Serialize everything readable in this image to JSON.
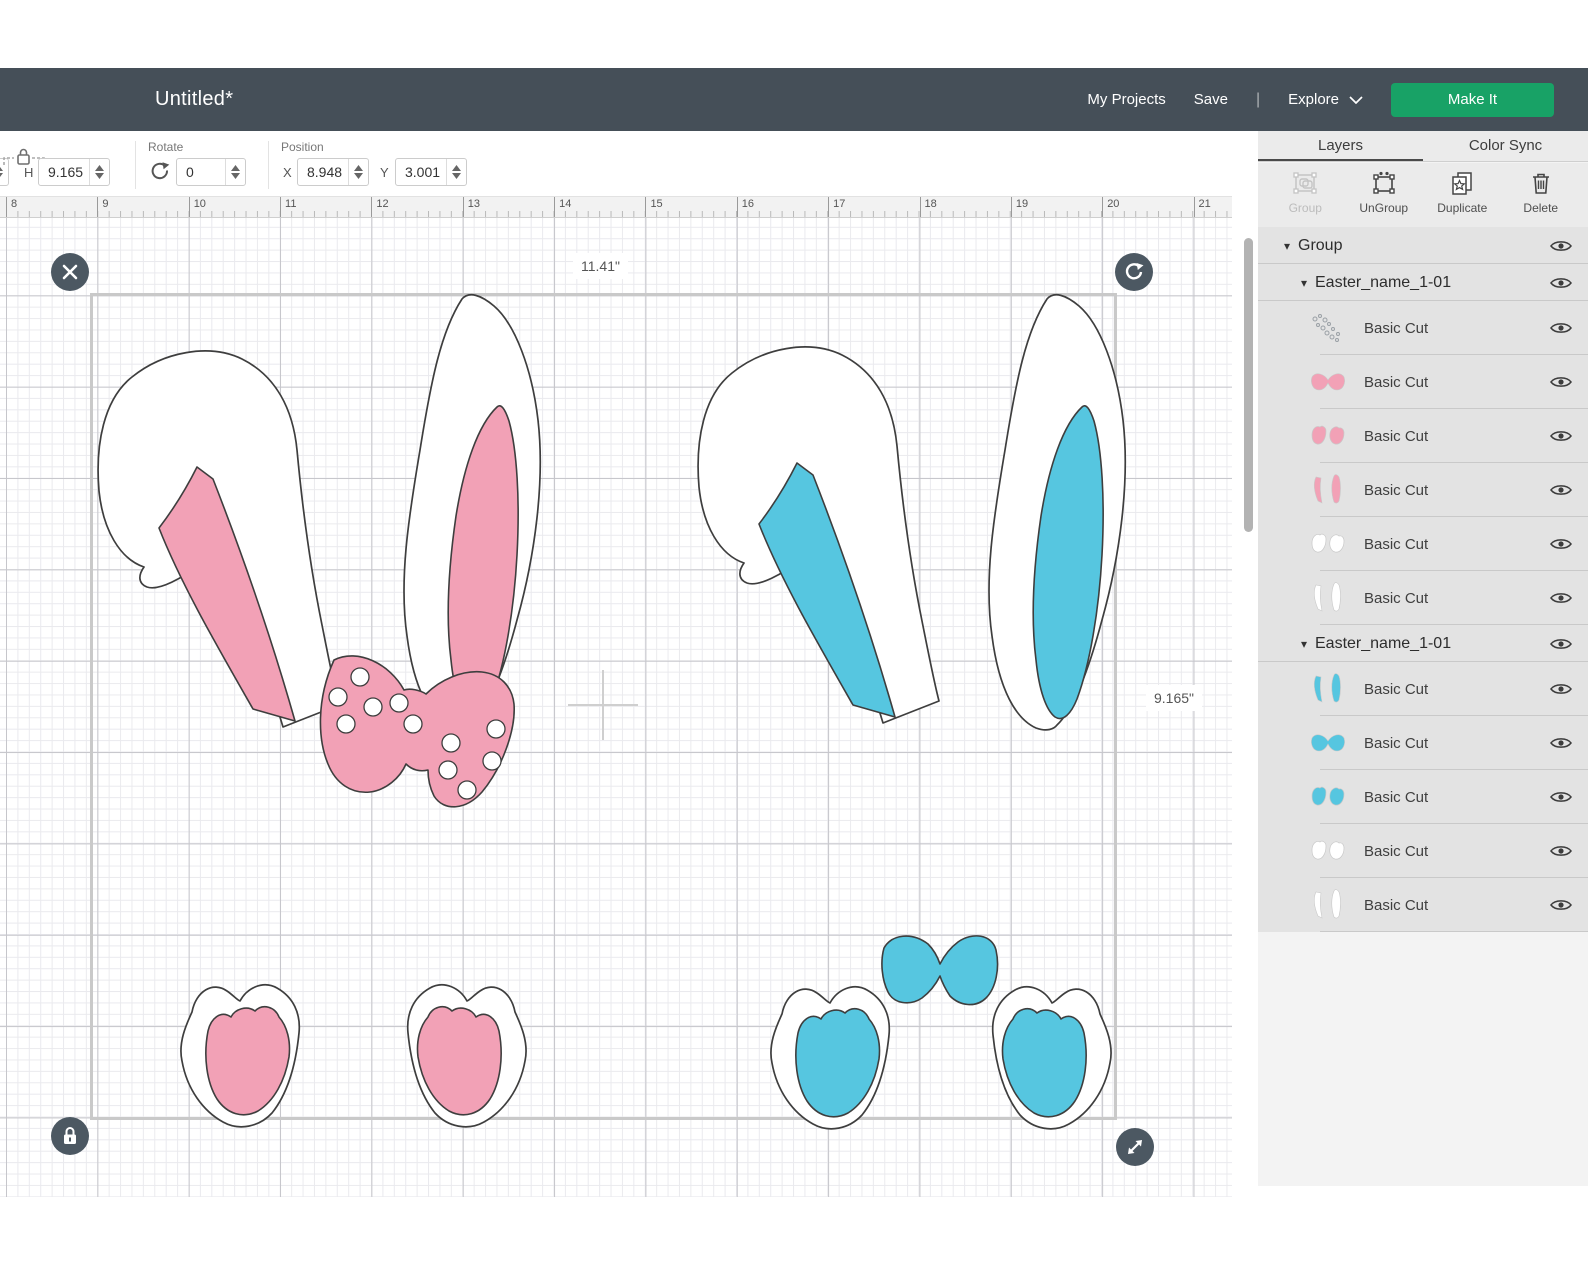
{
  "colors": {
    "header_bar": "#454F58",
    "make_it": "#18A266",
    "pink": "#F2A1B6",
    "blue": "#56C6E0",
    "outline": "#3E3E3E"
  },
  "header": {
    "title": "Untitled*",
    "my_projects": "My Projects",
    "save": "Save",
    "divider": "|",
    "explore": "Explore",
    "make_it": "Make It"
  },
  "toolbar": {
    "h_label": "H",
    "h_value": "9.165",
    "rotate_label": "Rotate",
    "rotate_value": "0",
    "position_label": "Position",
    "x_label": "X",
    "x_value": "8.948",
    "y_label": "Y",
    "y_value": "3.001"
  },
  "ruler": {
    "numbers": [
      "8",
      "9",
      "10",
      "11",
      "12",
      "13",
      "14",
      "15",
      "16",
      "17",
      "18",
      "19",
      "20",
      "21"
    ]
  },
  "canvas": {
    "selection_width_label": "11.41\"",
    "selection_height_label": "9.165\""
  },
  "panel": {
    "tabs": [
      {
        "label": "Layers",
        "active": true
      },
      {
        "label": "Color Sync",
        "active": false
      }
    ],
    "actions": [
      {
        "label": "Group",
        "disabled": true
      },
      {
        "label": "UnGroup",
        "disabled": false
      },
      {
        "label": "Duplicate",
        "disabled": false
      },
      {
        "label": "Delete",
        "disabled": false
      }
    ],
    "layers": [
      {
        "kind": "group",
        "label": "Group",
        "indent": 0
      },
      {
        "kind": "group",
        "label": "Easter_name_1-01",
        "indent": 1
      },
      {
        "kind": "item",
        "label": "Basic Cut",
        "thumb": "dots"
      },
      {
        "kind": "item",
        "label": "Basic Cut",
        "thumb": "bow-pink"
      },
      {
        "kind": "item",
        "label": "Basic Cut",
        "thumb": "pads-pink"
      },
      {
        "kind": "item",
        "label": "Basic Cut",
        "thumb": "ears-inner-pink"
      },
      {
        "kind": "item",
        "label": "Basic Cut",
        "thumb": "pads-white"
      },
      {
        "kind": "item",
        "label": "Basic Cut",
        "thumb": "ears-white"
      },
      {
        "kind": "group",
        "label": "Easter_name_1-01",
        "indent": 1
      },
      {
        "kind": "item",
        "label": "Basic Cut",
        "thumb": "ears-inner-blue"
      },
      {
        "kind": "item",
        "label": "Basic Cut",
        "thumb": "bow-blue"
      },
      {
        "kind": "item",
        "label": "Basic Cut",
        "thumb": "pads-blue"
      },
      {
        "kind": "item",
        "label": "Basic Cut",
        "thumb": "pads-white"
      },
      {
        "kind": "item",
        "label": "Basic Cut",
        "thumb": "ears-white"
      }
    ]
  }
}
